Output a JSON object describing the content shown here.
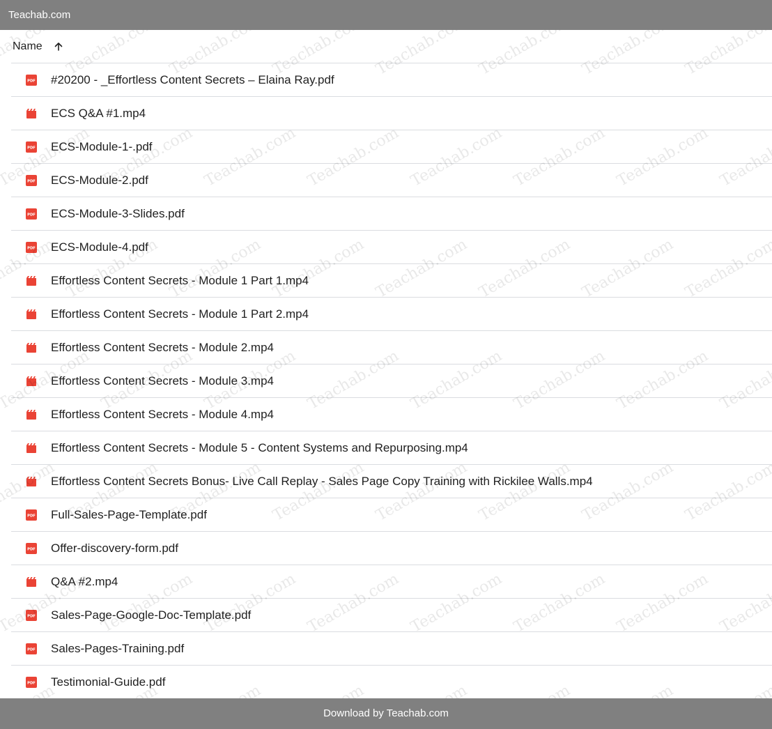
{
  "topbar": {
    "title": "Teachab.com"
  },
  "header": {
    "name_label": "Name",
    "sort_icon": "arrow-up-icon"
  },
  "files": [
    {
      "name": "#20200 - _Effortless Content Secrets – Elaina Ray.pdf",
      "type": "pdf"
    },
    {
      "name": "ECS Q&A #1.mp4",
      "type": "video"
    },
    {
      "name": "ECS-Module-1-.pdf",
      "type": "pdf"
    },
    {
      "name": "ECS-Module-2.pdf",
      "type": "pdf"
    },
    {
      "name": "ECS-Module-3-Slides.pdf",
      "type": "pdf"
    },
    {
      "name": "ECS-Module-4.pdf",
      "type": "pdf"
    },
    {
      "name": "Effortless Content Secrets - Module 1 Part 1.mp4",
      "type": "video"
    },
    {
      "name": "Effortless Content Secrets - Module 1 Part 2.mp4",
      "type": "video"
    },
    {
      "name": "Effortless Content Secrets - Module 2.mp4",
      "type": "video"
    },
    {
      "name": "Effortless Content Secrets - Module 3.mp4",
      "type": "video"
    },
    {
      "name": "Effortless Content Secrets - Module 4.mp4",
      "type": "video"
    },
    {
      "name": "Effortless Content Secrets - Module 5 - Content Systems and Repurposing.mp4",
      "type": "video"
    },
    {
      "name": "Effortless Content Secrets Bonus-  Live Call Replay - Sales Page Copy Training with Rickilee Walls.mp4",
      "type": "video"
    },
    {
      "name": "Full-Sales-Page-Template.pdf",
      "type": "pdf"
    },
    {
      "name": "Offer-discovery-form.pdf",
      "type": "pdf"
    },
    {
      "name": "Q&A #2.mp4",
      "type": "video"
    },
    {
      "name": "Sales-Page-Google-Doc-Template.pdf",
      "type": "pdf"
    },
    {
      "name": "Sales-Pages-Training.pdf",
      "type": "pdf"
    },
    {
      "name": "Testimonial-Guide.pdf",
      "type": "pdf"
    }
  ],
  "icons": {
    "pdf": "pdf-file-icon",
    "video": "video-file-icon"
  },
  "colors": {
    "bar": "#808080",
    "file_icon": "#ea4335",
    "divider": "#dadce0"
  },
  "watermark": {
    "text": "Teachab.com"
  },
  "footer": {
    "text": "Download by Teachab.com"
  }
}
